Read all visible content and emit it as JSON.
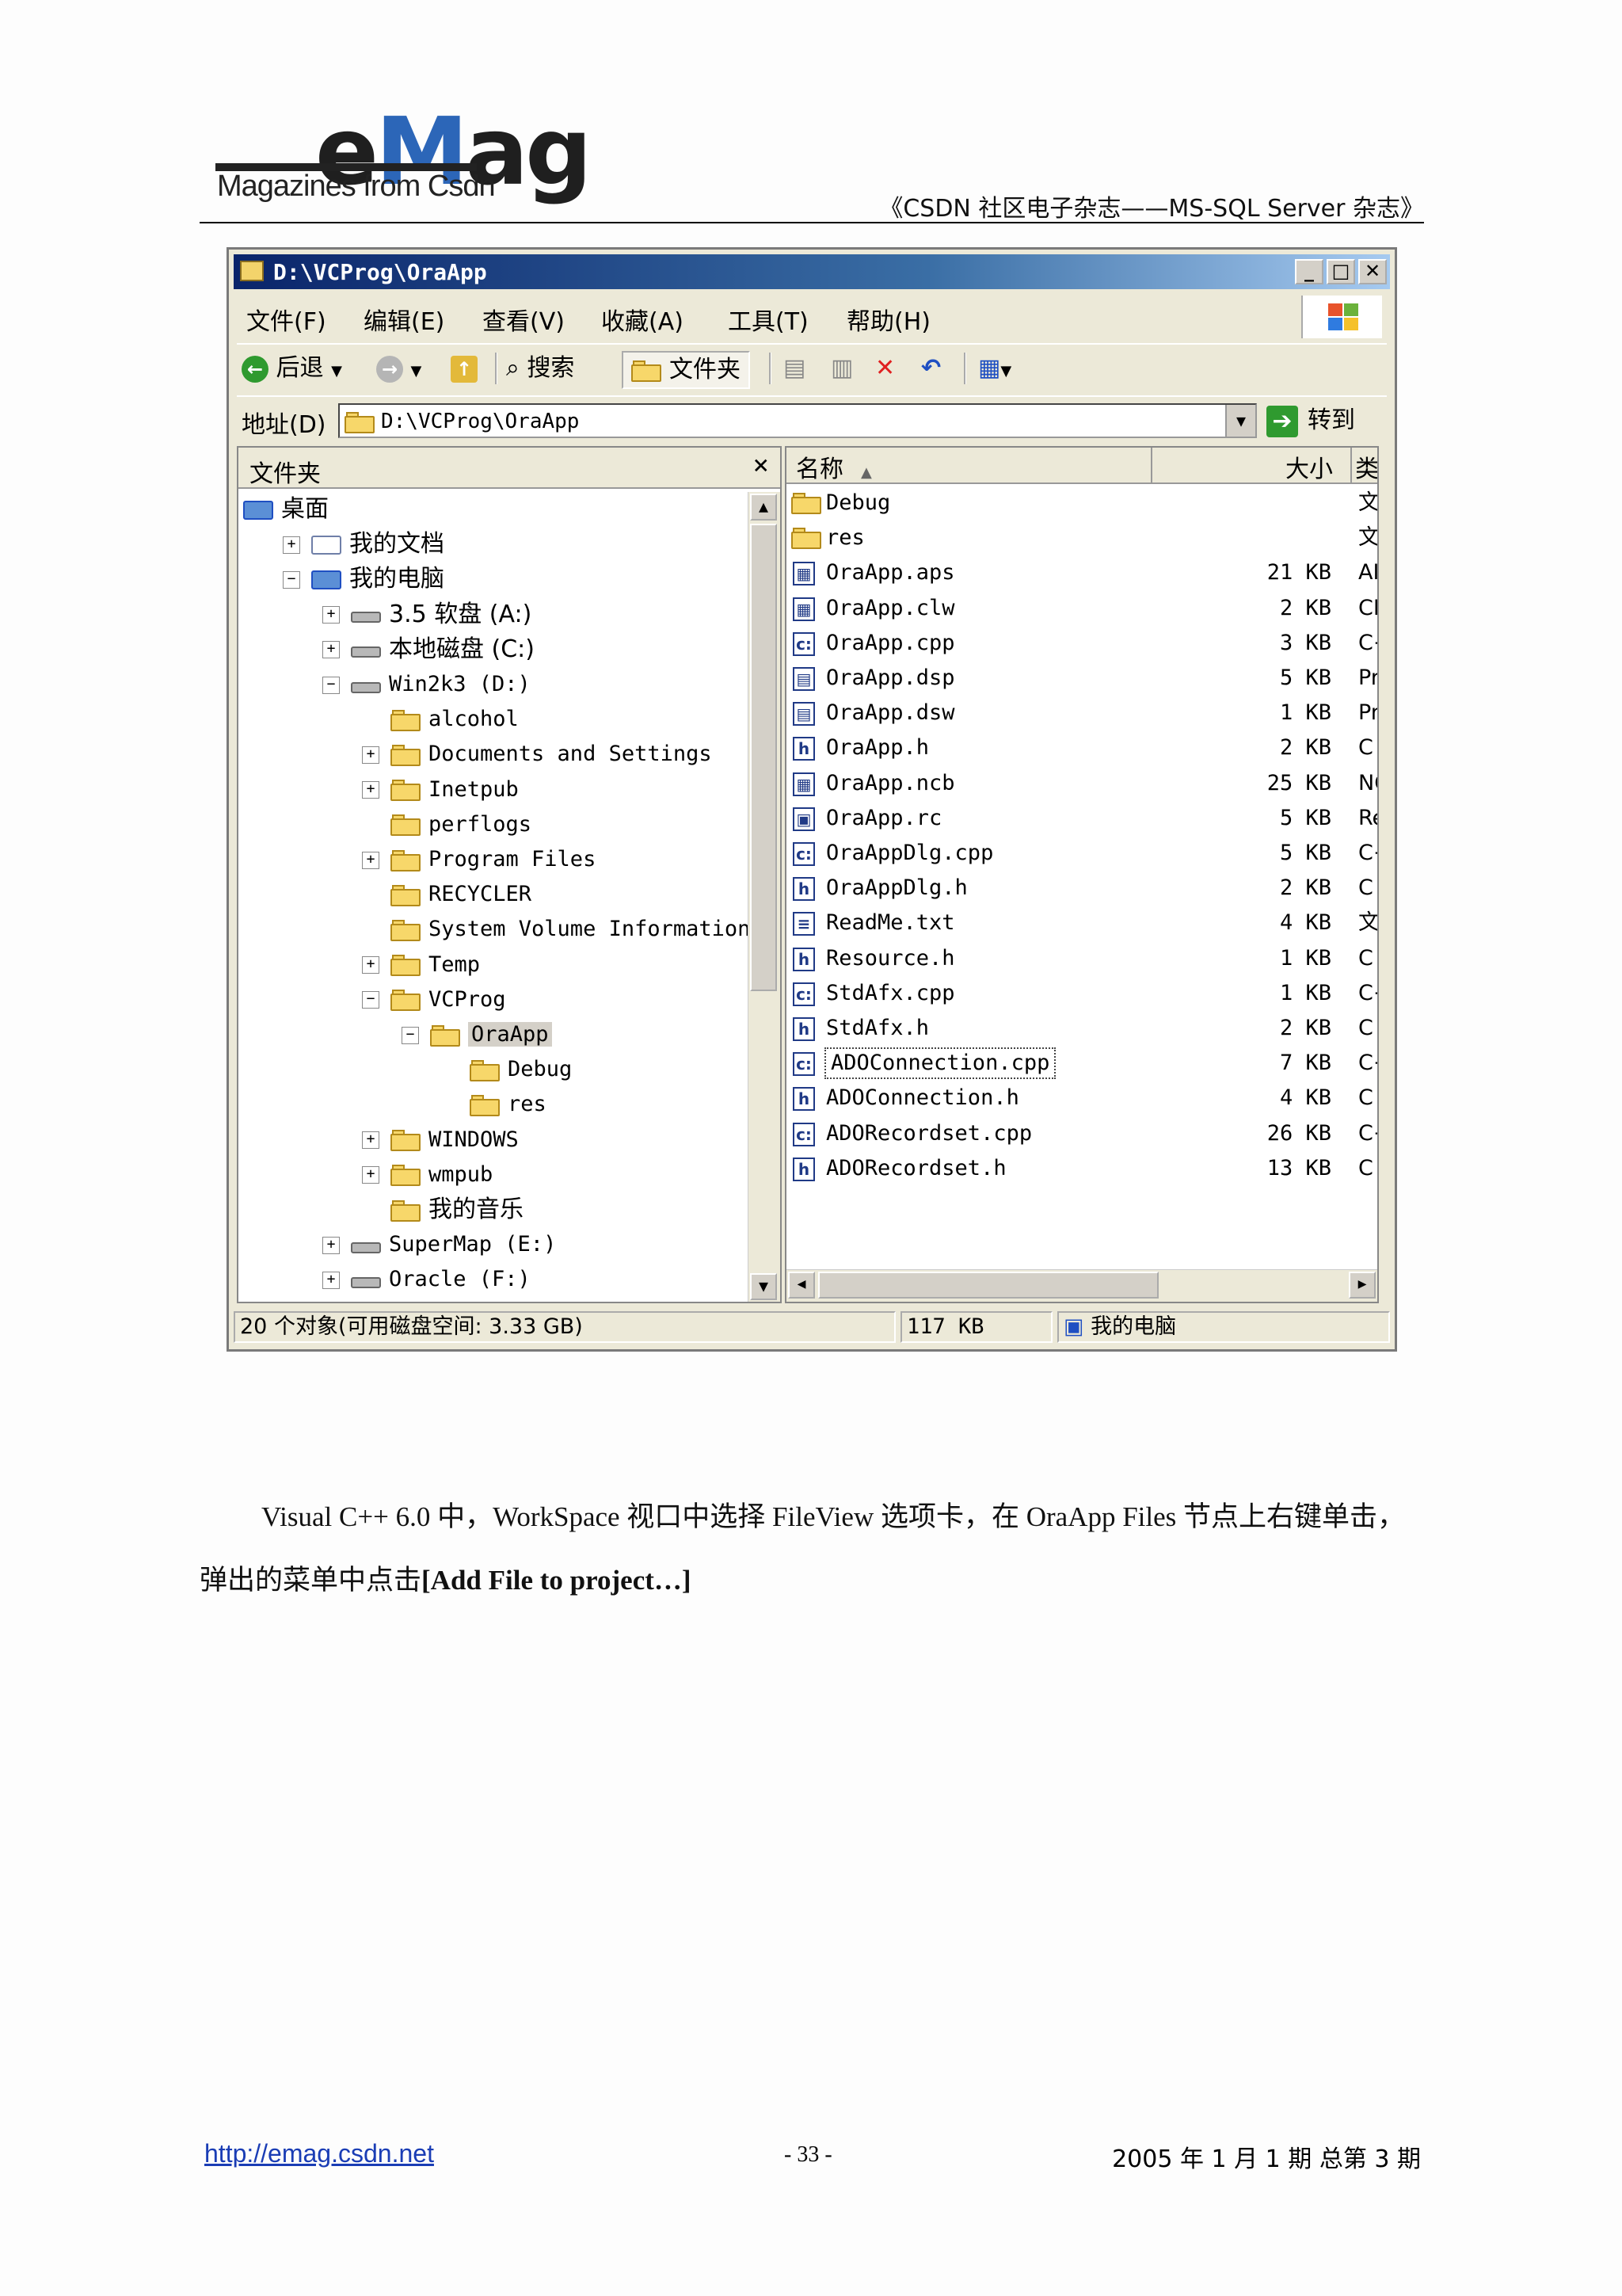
{
  "header": {
    "logo_main_e": "e",
    "logo_main_m": "M",
    "logo_main_ag": "ag",
    "logo_sub": "Magazines from Csdn",
    "title": "《CSDN 社区电子杂志——MS-SQL Server 杂志》"
  },
  "window": {
    "title": "D:\\VCProg\\OraApp",
    "menu": [
      "文件(F)",
      "编辑(E)",
      "查看(V)",
      "收藏(A)",
      "工具(T)",
      "帮助(H)"
    ],
    "toolbar": {
      "back": "后退",
      "search": "搜索",
      "folders": "文件夹"
    },
    "address": {
      "label": "地址(D)",
      "value": "D:\\VCProg\\OraApp",
      "go": "转到"
    },
    "folders_pane": {
      "title": "文件夹",
      "tree": [
        {
          "label": "桌面",
          "indent": 0,
          "expander": "",
          "icon": "desktop-icon",
          "cn": true
        },
        {
          "label": "我的文档",
          "indent": 1,
          "expander": "+",
          "icon": "documents-icon",
          "cn": true
        },
        {
          "label": "我的电脑",
          "indent": 1,
          "expander": "−",
          "icon": "computer-icon",
          "cn": true
        },
        {
          "label": "3.5 软盘 (A:)",
          "indent": 2,
          "expander": "+",
          "icon": "floppy-icon",
          "cn": true
        },
        {
          "label": "本地磁盘 (C:)",
          "indent": 2,
          "expander": "+",
          "icon": "drive-icon",
          "cn": true
        },
        {
          "label": "Win2k3 (D:)",
          "indent": 2,
          "expander": "−",
          "icon": "drive-icon",
          "cn": false
        },
        {
          "label": "alcohol",
          "indent": 3,
          "expander": "",
          "icon": "folder-icon",
          "cn": false
        },
        {
          "label": "Documents and Settings",
          "indent": 3,
          "expander": "+",
          "icon": "folder-icon",
          "cn": false
        },
        {
          "label": "Inetpub",
          "indent": 3,
          "expander": "+",
          "icon": "folder-icon",
          "cn": false
        },
        {
          "label": "perflogs",
          "indent": 3,
          "expander": "",
          "icon": "folder-icon",
          "cn": false
        },
        {
          "label": "Program Files",
          "indent": 3,
          "expander": "+",
          "icon": "folder-icon",
          "cn": false
        },
        {
          "label": "RECYCLER",
          "indent": 3,
          "expander": "",
          "icon": "folder-icon",
          "cn": false
        },
        {
          "label": "System Volume Information",
          "indent": 3,
          "expander": "",
          "icon": "folder-icon",
          "cn": false
        },
        {
          "label": "Temp",
          "indent": 3,
          "expander": "+",
          "icon": "folder-icon",
          "cn": false
        },
        {
          "label": "VCProg",
          "indent": 3,
          "expander": "−",
          "icon": "folder-icon",
          "cn": false
        },
        {
          "label": "OraApp",
          "indent": 4,
          "expander": "−",
          "icon": "folder-open-icon",
          "cn": false,
          "selected": true
        },
        {
          "label": "Debug",
          "indent": 5,
          "expander": "",
          "icon": "folder-icon",
          "cn": false
        },
        {
          "label": "res",
          "indent": 5,
          "expander": "",
          "icon": "folder-icon",
          "cn": false
        },
        {
          "label": "WINDOWS",
          "indent": 3,
          "expander": "+",
          "icon": "folder-icon",
          "cn": false
        },
        {
          "label": "wmpub",
          "indent": 3,
          "expander": "+",
          "icon": "folder-icon",
          "cn": false
        },
        {
          "label": "我的音乐",
          "indent": 3,
          "expander": "",
          "icon": "folder-icon",
          "cn": true
        },
        {
          "label": "SuperMap (E:)",
          "indent": 2,
          "expander": "+",
          "icon": "drive-icon",
          "cn": false
        },
        {
          "label": "Oracle (F:)",
          "indent": 2,
          "expander": "+",
          "icon": "drive-icon",
          "cn": false
        }
      ]
    },
    "file_list": {
      "columns": [
        "名称",
        "大小",
        "类"
      ],
      "files": [
        {
          "name": "Debug",
          "size": "",
          "type": "文",
          "icon": "folder"
        },
        {
          "name": "res",
          "size": "",
          "type": "文",
          "icon": "folder"
        },
        {
          "name": "OraApp.aps",
          "size": "21 KB",
          "type": "AI",
          "icon": "file"
        },
        {
          "name": "OraApp.clw",
          "size": "2 KB",
          "type": "CI",
          "icon": "file"
        },
        {
          "name": "OraApp.cpp",
          "size": "3 KB",
          "type": "C+",
          "icon": "cpp"
        },
        {
          "name": "OraApp.dsp",
          "size": "5 KB",
          "type": "Pr",
          "icon": "proj"
        },
        {
          "name": "OraApp.dsw",
          "size": "1 KB",
          "type": "Pr",
          "icon": "proj"
        },
        {
          "name": "OraApp.h",
          "size": "2 KB",
          "type": "C",
          "icon": "h"
        },
        {
          "name": "OraApp.ncb",
          "size": "25 KB",
          "type": "NC",
          "icon": "file"
        },
        {
          "name": "OraApp.rc",
          "size": "5 KB",
          "type": "Re",
          "icon": "rc"
        },
        {
          "name": "OraAppDlg.cpp",
          "size": "5 KB",
          "type": "C+",
          "icon": "cpp"
        },
        {
          "name": "OraAppDlg.h",
          "size": "2 KB",
          "type": "C",
          "icon": "h"
        },
        {
          "name": "ReadMe.txt",
          "size": "4 KB",
          "type": "文",
          "icon": "txt"
        },
        {
          "name": "Resource.h",
          "size": "1 KB",
          "type": "C",
          "icon": "h"
        },
        {
          "name": "StdAfx.cpp",
          "size": "1 KB",
          "type": "C+",
          "icon": "cpp"
        },
        {
          "name": "StdAfx.h",
          "size": "2 KB",
          "type": "C",
          "icon": "h"
        },
        {
          "name": "ADOConnection.cpp",
          "size": "7 KB",
          "type": "C+",
          "icon": "cpp",
          "focused": true
        },
        {
          "name": "ADOConnection.h",
          "size": "4 KB",
          "type": "C",
          "icon": "h"
        },
        {
          "name": "ADORecordset.cpp",
          "size": "26 KB",
          "type": "C+",
          "icon": "cpp"
        },
        {
          "name": "ADORecordset.h",
          "size": "13 KB",
          "type": "C",
          "icon": "h"
        }
      ]
    },
    "status": {
      "objects": "20 个对象(可用磁盘空间: 3.33 GB)",
      "size": "117 KB",
      "location": "我的电脑"
    }
  },
  "body": {
    "para1": "Visual C++ 6.0 中，WorkSpace 视口中选择 FileView 选项卡，在 OraApp Files 节点上右键单击，",
    "para2_prefix": "弹出的菜单中点击",
    "para2_bold": "[Add File to project…]"
  },
  "footer": {
    "link": "http://emag.csdn.net",
    "page": "- 33 -",
    "issue": "2005 年 1 月 1 期  总第 3 期"
  }
}
